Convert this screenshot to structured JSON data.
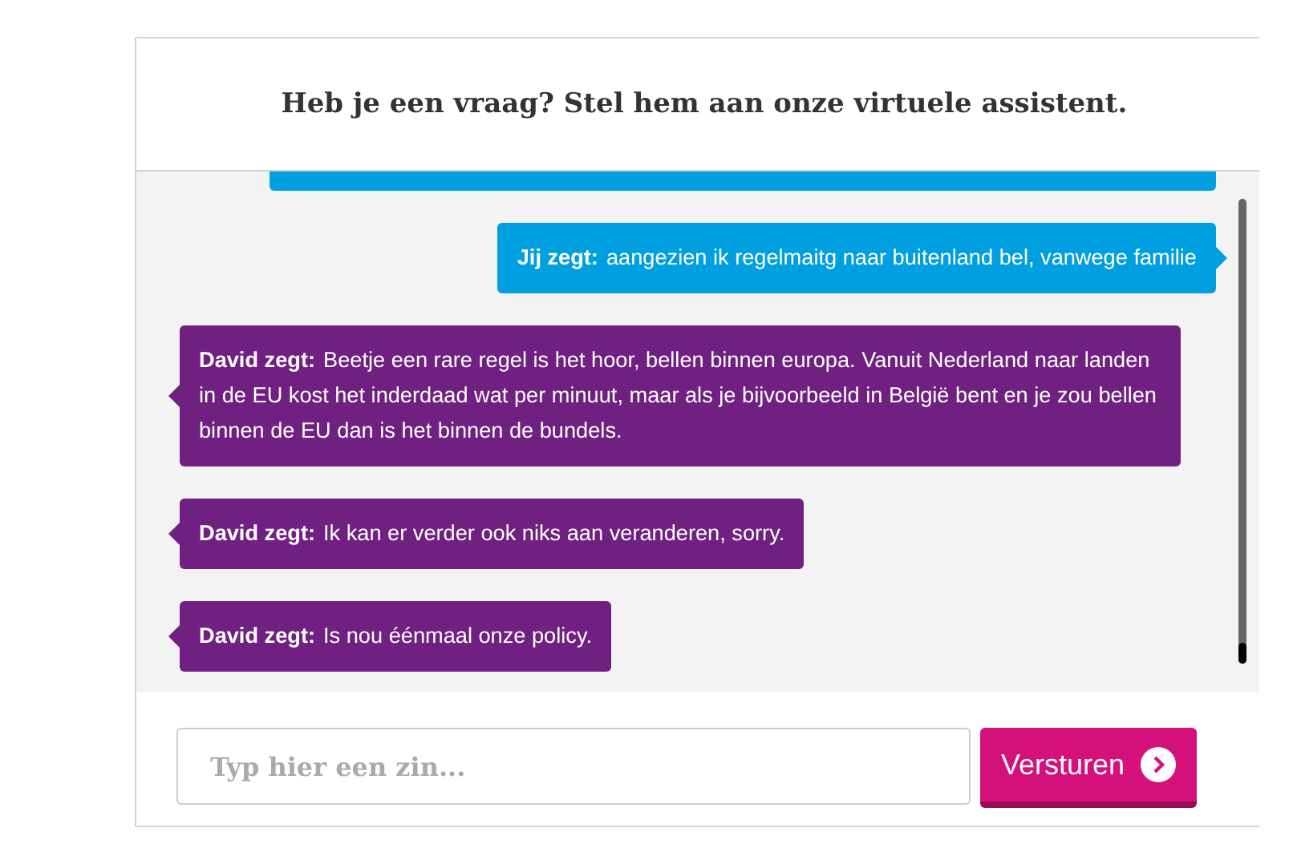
{
  "header": {
    "title": "Heb je een vraag? Stel hem aan onze virtuele assistent."
  },
  "messages": [
    {
      "kind": "user",
      "speaker": "Jij zegt:",
      "text": "aangezien ik regelmaitg naar buitenland bel, vanwege familie"
    },
    {
      "kind": "bot",
      "speaker": "David zegt:",
      "text": "Beetje een rare regel is het hoor, bellen binnen europa. Vanuit Nederland naar landen in de EU kost het inderdaad wat per minuut, maar als je bijvoorbeeld in België bent en je zou bellen binnen de EU dan is het binnen de bundels."
    },
    {
      "kind": "bot",
      "speaker": "David zegt:",
      "text": "Ik kan er verder ook niks aan veranderen, sorry."
    },
    {
      "kind": "bot",
      "speaker": "David zegt:",
      "text": "Is nou éénmaal onze policy."
    }
  ],
  "input": {
    "placeholder": "Typ hier een zin..."
  },
  "send_button": {
    "label": "Versturen"
  }
}
